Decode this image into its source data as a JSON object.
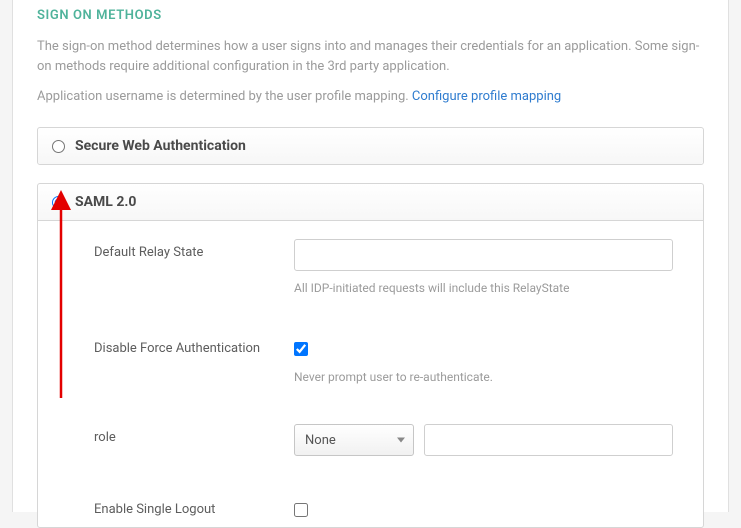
{
  "section_title": "SIGN ON METHODS",
  "description": "The sign-on method determines how a user signs into and manages their credentials for an application. Some sign-on methods require additional configuration in the 3rd party application.",
  "username_text": "Application username is determined by the user profile mapping. ",
  "configure_link": "Configure profile mapping",
  "methods": {
    "swa": {
      "label": "Secure Web Authentication"
    },
    "saml": {
      "label": "SAML 2.0"
    }
  },
  "fields": {
    "relay": {
      "label": "Default Relay State",
      "value": "",
      "helper": "All IDP-initiated requests will include this RelayState"
    },
    "force_auth": {
      "label": "Disable Force Authentication",
      "helper": "Never prompt user to re-authenticate."
    },
    "role": {
      "label": "role",
      "selected": "None",
      "extra_value": ""
    },
    "slo": {
      "label": "Enable Single Logout"
    }
  }
}
